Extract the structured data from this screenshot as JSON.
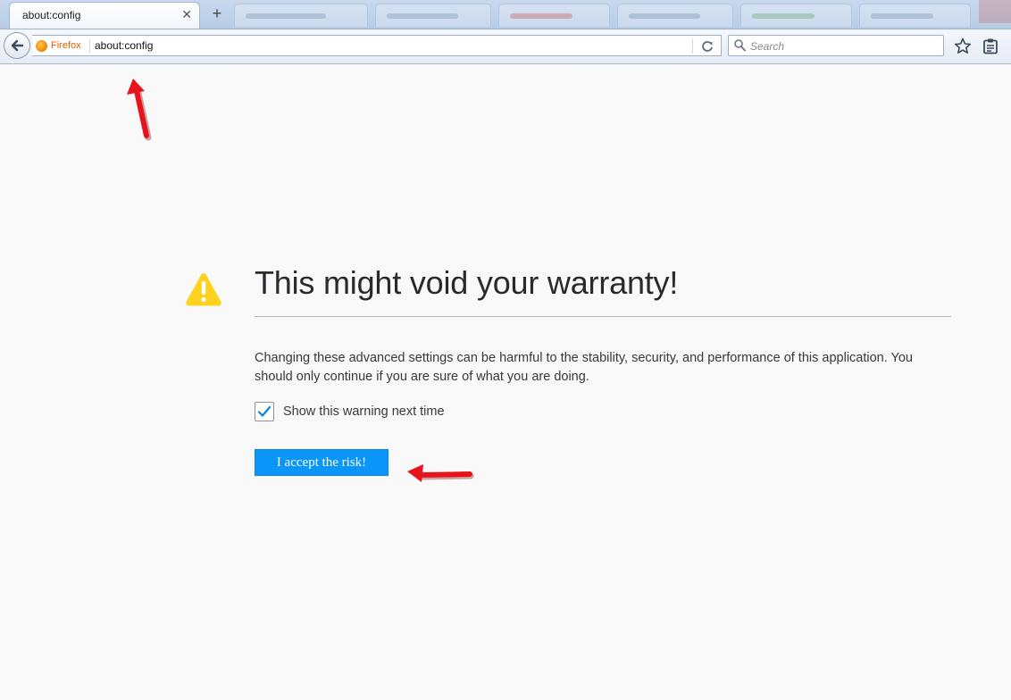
{
  "browser": {
    "tab": {
      "title": "about:config"
    },
    "identity_label": "Firefox",
    "url": "about:config",
    "search_placeholder": "Search"
  },
  "page": {
    "title": "This might void your warranty!",
    "description": "Changing these advanced settings can be harmful to the stability, security, and performance of this application. You should only continue if you are sure of what you are doing.",
    "show_warning_label": "Show this warning next time",
    "show_warning_checked": true,
    "accept_button": "I accept the risk!"
  },
  "colors": {
    "accent": "#0996f8",
    "warning": "#ffd21f",
    "annotation_arrow": "#e8141b",
    "firefox_orange": "#e66000"
  },
  "icons": [
    "back-arrow-icon",
    "firefox-logo-icon",
    "reload-icon",
    "search-icon",
    "bookmark-star-icon",
    "reading-list-icon",
    "warning-icon",
    "checkmark-icon",
    "close-icon",
    "plus-icon"
  ]
}
